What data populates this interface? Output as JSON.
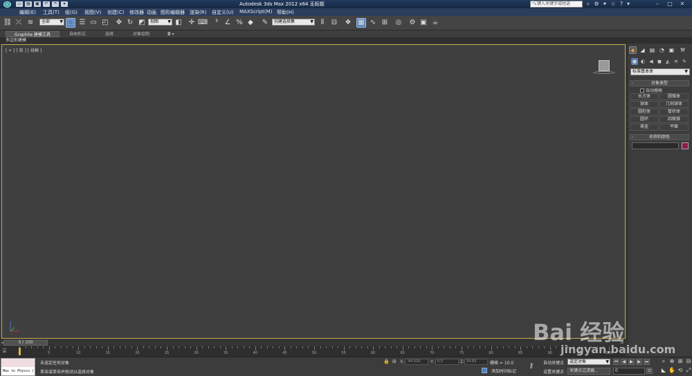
{
  "titlebar": {
    "title": "Autodesk 3ds Max  2012 x64       无标题",
    "help_search_placeholder": "键入关键字或短语"
  },
  "menu": [
    "编辑(E)",
    "工具(T)",
    "组(G)",
    "视图(V)",
    "创建(C)",
    "修改器",
    "动画",
    "图形编辑器",
    "渲染(R)",
    "自定义(U)",
    "MAXScript(M)",
    "帮助(H)"
  ],
  "toolbar": {
    "filter_value": "全部",
    "refcoord_value": "视图",
    "named_selection_placeholder": "创建选择集"
  },
  "ribbon": {
    "tabs": [
      "Graphite 建模工具",
      "自由形式",
      "选择",
      "对象绘制"
    ],
    "sub_label": "多边形建模"
  },
  "viewport": {
    "label": "[ + ] [ 前 ] [ 线框 ]"
  },
  "command_panel": {
    "category": "标准基本体",
    "object_type_title": "对象类型",
    "autogrid_label": "自动栅格",
    "objects": [
      "长方体",
      "圆锥体",
      "球体",
      "几何球体",
      "圆柱体",
      "管状体",
      "圆环",
      "四棱锥",
      "茶壶",
      "平面"
    ],
    "name_color_title": "名称和颜色",
    "swatch_color": "#8b1d4a"
  },
  "timeline": {
    "frame_display": "0 / 100",
    "ticks": [
      0,
      5,
      10,
      15,
      20,
      25,
      30,
      35,
      40,
      45,
      50,
      55,
      60,
      65,
      70,
      75,
      80,
      85,
      90,
      95,
      100
    ],
    "current_frame": 0
  },
  "status": {
    "maxscript_text": "Max to Physcs (",
    "line1": "未选定任何对象",
    "line2": "单击或单击并拖动以选择对象",
    "x_label": "X:",
    "y_label": "Y:",
    "z_label": "Z:",
    "x_value": "-44.016",
    "y_value": "0.0",
    "z_value": "54.83",
    "grid": "栅格 = 10.0",
    "add_time_tag": "添加时间标记",
    "auto_key": "自动关键点",
    "set_key": "设置关键点",
    "selected_object": "选定对象",
    "key_filters": "关键点过滤器...",
    "frame_value": "0"
  },
  "watermark": {
    "text": "Bai 经验",
    "url": "jingyan.baidu.com"
  }
}
